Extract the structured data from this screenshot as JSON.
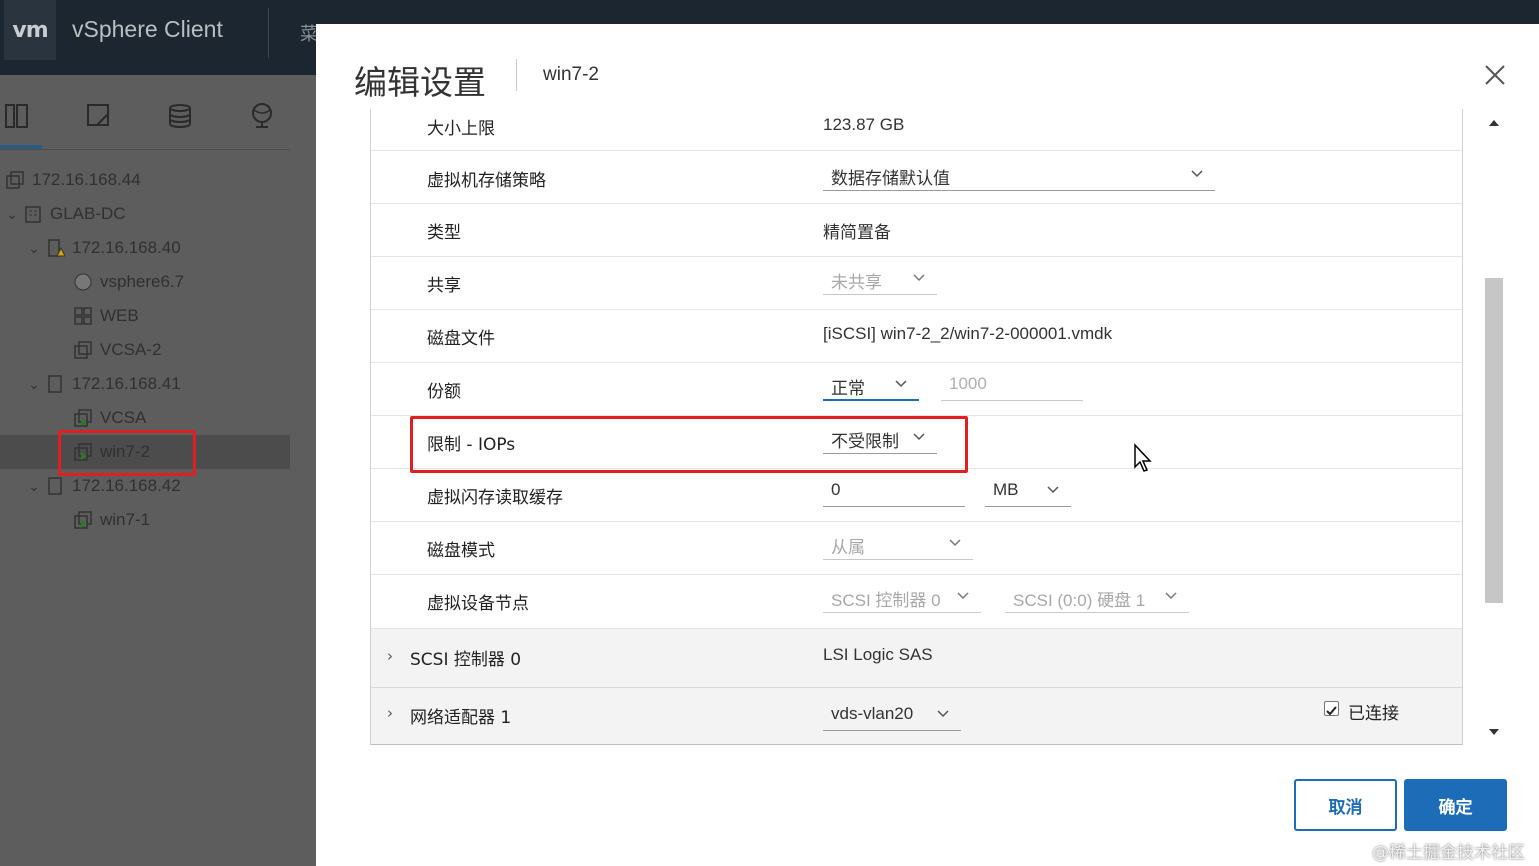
{
  "app": {
    "logo": "vm",
    "title": "vSphere Client",
    "menu_text": "菜"
  },
  "sidebar": {
    "tabs": [
      {
        "icon": "hosts-clusters-icon"
      },
      {
        "icon": "vms-templates-icon"
      },
      {
        "icon": "storage-icon"
      },
      {
        "icon": "networking-icon"
      }
    ],
    "tree": [
      {
        "label": "172.16.168.44",
        "icon": "vcenter-icon",
        "expanded": null
      },
      {
        "label": "GLAB-DC",
        "icon": "datacenter-icon",
        "expanded": true
      },
      {
        "label": "172.16.168.40",
        "icon": "host-warning-icon",
        "expanded": true
      },
      {
        "label": "vsphere6.7",
        "icon": "vm-off-icon",
        "expanded": null
      },
      {
        "label": "WEB",
        "icon": "vm-group-icon",
        "expanded": null
      },
      {
        "label": "VCSA-2",
        "icon": "vm-icon",
        "expanded": null
      },
      {
        "label": "172.16.168.41",
        "icon": "host-icon",
        "expanded": true
      },
      {
        "label": "VCSA",
        "icon": "vm-on-icon",
        "expanded": null
      },
      {
        "label": "win7-2",
        "icon": "vm-on-icon",
        "expanded": null,
        "selected": true
      },
      {
        "label": "172.16.168.42",
        "icon": "host-icon",
        "expanded": true
      },
      {
        "label": "win7-1",
        "icon": "vm-on-icon",
        "expanded": null
      }
    ]
  },
  "dialog": {
    "title": "编辑设置",
    "subtitle": "win7-2",
    "rows": {
      "max_size": {
        "label": "大小上限",
        "value": "123.87 GB"
      },
      "storage_policy": {
        "label": "虚拟机存储策略",
        "value": "数据存储默认值"
      },
      "type": {
        "label": "类型",
        "value": "精简置备"
      },
      "sharing": {
        "label": "共享",
        "value": "未共享"
      },
      "disk_file": {
        "label": "磁盘文件",
        "value": "[iSCSI] win7-2_2/win7-2-000001.vmdk"
      },
      "shares": {
        "label": "份额",
        "value": "正常",
        "amount_placeholder": "1000"
      },
      "limit_iops": {
        "label": "限制 - IOPs",
        "value": "不受限制"
      },
      "flash_cache": {
        "label": "虚拟闪存读取缓存",
        "value": "0",
        "unit": "MB"
      },
      "disk_mode": {
        "label": "磁盘模式",
        "value": "从属"
      },
      "device_node": {
        "label": "虚拟设备节点",
        "controller": "SCSI 控制器 0",
        "node": "SCSI (0:0) 硬盘 1"
      },
      "scsi_controller": {
        "label": "SCSI 控制器 0",
        "value": "LSI Logic SAS"
      },
      "network_adapter": {
        "label": "网络适配器 1",
        "value": "vds-vlan20",
        "connected_label": "已连接",
        "connected": true
      }
    },
    "buttons": {
      "cancel": "取消",
      "ok": "确定"
    }
  },
  "watermark": "@稀土掘金技术社区"
}
